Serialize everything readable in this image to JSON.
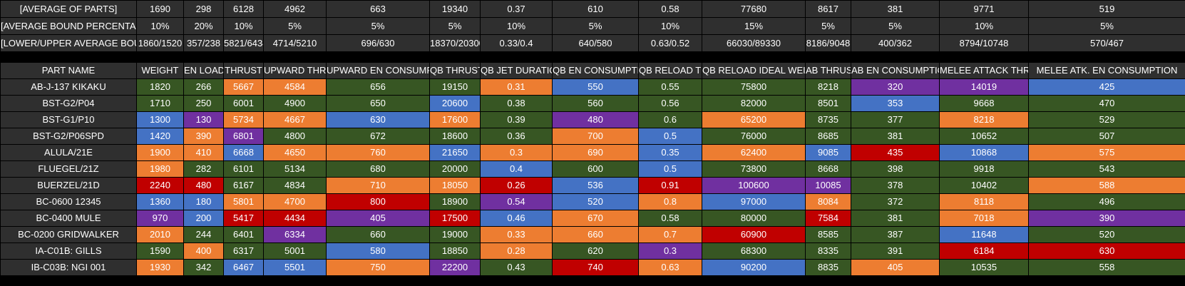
{
  "colors": {
    "green": "#375623",
    "orange": "#ed7d31",
    "blue": "#4472c4",
    "purple": "#7030a0",
    "red": "#c00000",
    "header": "#2f2f2f"
  },
  "summary": [
    {
      "label": "[AVERAGE OF PARTS]",
      "values": [
        "1690",
        "298",
        "6128",
        "4962",
        "663",
        "19340",
        "0.37",
        "610",
        "0.58",
        "77680",
        "8617",
        "381",
        "9771",
        "519"
      ]
    },
    {
      "label": "[AVERAGE BOUND PERCENTAGE]",
      "values": [
        "10%",
        "20%",
        "10%",
        "5%",
        "5%",
        "5%",
        "10%",
        "5%",
        "10%",
        "15%",
        "5%",
        "5%",
        "10%",
        "5%"
      ]
    },
    {
      "label": "[LOWER/UPPER AVERAGE BOUNDS]",
      "values": [
        "1860/1520",
        "357/238",
        "5821/6434",
        "4714/5210",
        "696/630",
        "18370/20300",
        "0.33/0.4",
        "640/580",
        "0.63/0.52",
        "66030/89330",
        "8186/9048",
        "400/362",
        "8794/10748",
        "570/467"
      ]
    }
  ],
  "headers": [
    "PART NAME",
    "WEIGHT",
    "EN LOAD",
    "THRUST",
    "UPWARD THRUST",
    "UPWARD EN CONSUMPTION",
    "QB THRUST",
    "QB JET DURATION",
    "QB EN CONSUMPTION",
    "QB RELOAD TIME",
    "QB RELOAD IDEAL WEIGHT",
    "AB THRUST",
    "AB EN CONSUMPTION",
    "MELEE ATTACK THRUST",
    "MELEE ATK. EN CONSUMPTION"
  ],
  "rows": [
    {
      "name": "AB-J-137 KIKAKU",
      "values": [
        "1820",
        "266",
        "5667",
        "4584",
        "656",
        "19150",
        "0.31",
        "550",
        "0.55",
        "75800",
        "8218",
        "320",
        "14019",
        "425"
      ],
      "colors": [
        "green",
        "green",
        "orange",
        "orange",
        "green",
        "green",
        "orange",
        "blue",
        "green",
        "green",
        "green",
        "purple",
        "purple",
        "blue"
      ]
    },
    {
      "name": "BST-G2/P04",
      "values": [
        "1710",
        "250",
        "6001",
        "4900",
        "650",
        "20600",
        "0.38",
        "560",
        "0.56",
        "82000",
        "8501",
        "353",
        "9668",
        "470"
      ],
      "colors": [
        "green",
        "green",
        "green",
        "green",
        "green",
        "blue",
        "green",
        "green",
        "green",
        "green",
        "green",
        "blue",
        "green",
        "green"
      ]
    },
    {
      "name": "BST-G1/P10",
      "values": [
        "1300",
        "130",
        "5734",
        "4667",
        "630",
        "17600",
        "0.39",
        "480",
        "0.6",
        "65200",
        "8735",
        "377",
        "8218",
        "529"
      ],
      "colors": [
        "blue",
        "purple",
        "orange",
        "orange",
        "blue",
        "orange",
        "green",
        "purple",
        "green",
        "orange",
        "green",
        "green",
        "orange",
        "green"
      ]
    },
    {
      "name": "BST-G2/P06SPD",
      "values": [
        "1420",
        "390",
        "6801",
        "4800",
        "672",
        "18600",
        "0.36",
        "700",
        "0.5",
        "76000",
        "8685",
        "381",
        "10652",
        "507"
      ],
      "colors": [
        "blue",
        "orange",
        "purple",
        "green",
        "green",
        "green",
        "green",
        "orange",
        "blue",
        "green",
        "green",
        "green",
        "green",
        "green"
      ]
    },
    {
      "name": "ALULA/21E",
      "values": [
        "1900",
        "410",
        "6668",
        "4650",
        "760",
        "21650",
        "0.3",
        "690",
        "0.35",
        "62400",
        "9085",
        "435",
        "10868",
        "575"
      ],
      "colors": [
        "orange",
        "orange",
        "blue",
        "orange",
        "orange",
        "blue",
        "orange",
        "orange",
        "blue",
        "orange",
        "blue",
        "red",
        "blue",
        "orange"
      ]
    },
    {
      "name": "FLUEGEL/21Z",
      "values": [
        "1980",
        "282",
        "6101",
        "5134",
        "680",
        "20000",
        "0.4",
        "600",
        "0.5",
        "73800",
        "8668",
        "398",
        "9918",
        "543"
      ],
      "colors": [
        "orange",
        "green",
        "green",
        "green",
        "green",
        "green",
        "blue",
        "green",
        "blue",
        "green",
        "green",
        "green",
        "green",
        "green"
      ]
    },
    {
      "name": "BUERZEL/21D",
      "values": [
        "2240",
        "480",
        "6167",
        "4834",
        "710",
        "18050",
        "0.26",
        "536",
        "0.91",
        "100600",
        "10085",
        "378",
        "10402",
        "588"
      ],
      "colors": [
        "red",
        "red",
        "green",
        "green",
        "orange",
        "orange",
        "red",
        "blue",
        "red",
        "purple",
        "purple",
        "green",
        "green",
        "orange"
      ]
    },
    {
      "name": "BC-0600 12345",
      "values": [
        "1360",
        "180",
        "5801",
        "4700",
        "800",
        "18900",
        "0.54",
        "520",
        "0.8",
        "97000",
        "8084",
        "372",
        "8118",
        "496"
      ],
      "colors": [
        "blue",
        "blue",
        "orange",
        "orange",
        "red",
        "green",
        "purple",
        "blue",
        "orange",
        "blue",
        "orange",
        "green",
        "orange",
        "green"
      ]
    },
    {
      "name": "BC-0400 MULE",
      "values": [
        "970",
        "200",
        "5417",
        "4434",
        "405",
        "17500",
        "0.46",
        "670",
        "0.58",
        "80000",
        "7584",
        "381",
        "7018",
        "390"
      ],
      "colors": [
        "purple",
        "blue",
        "red",
        "red",
        "purple",
        "red",
        "blue",
        "orange",
        "green",
        "green",
        "red",
        "green",
        "orange",
        "purple"
      ]
    },
    {
      "name": "BC-0200 GRIDWALKER",
      "values": [
        "2010",
        "244",
        "6401",
        "6334",
        "660",
        "19000",
        "0.33",
        "660",
        "0.7",
        "60900",
        "8585",
        "387",
        "11648",
        "520"
      ],
      "colors": [
        "orange",
        "green",
        "green",
        "purple",
        "green",
        "green",
        "orange",
        "orange",
        "orange",
        "red",
        "green",
        "green",
        "blue",
        "green"
      ]
    },
    {
      "name": "IA-C01B: GILLS",
      "values": [
        "1590",
        "400",
        "6317",
        "5001",
        "580",
        "18850",
        "0.28",
        "620",
        "0.3",
        "68300",
        "8335",
        "391",
        "6184",
        "630"
      ],
      "colors": [
        "green",
        "orange",
        "green",
        "green",
        "blue",
        "green",
        "orange",
        "green",
        "purple",
        "green",
        "green",
        "green",
        "red",
        "red"
      ]
    },
    {
      "name": "IB-C03B: NGI 001",
      "values": [
        "1930",
        "342",
        "6467",
        "5501",
        "750",
        "22200",
        "0.43",
        "740",
        "0.63",
        "90200",
        "8835",
        "405",
        "10535",
        "558"
      ],
      "colors": [
        "orange",
        "green",
        "blue",
        "blue",
        "orange",
        "purple",
        "green",
        "red",
        "orange",
        "blue",
        "green",
        "orange",
        "green",
        "green"
      ]
    }
  ]
}
